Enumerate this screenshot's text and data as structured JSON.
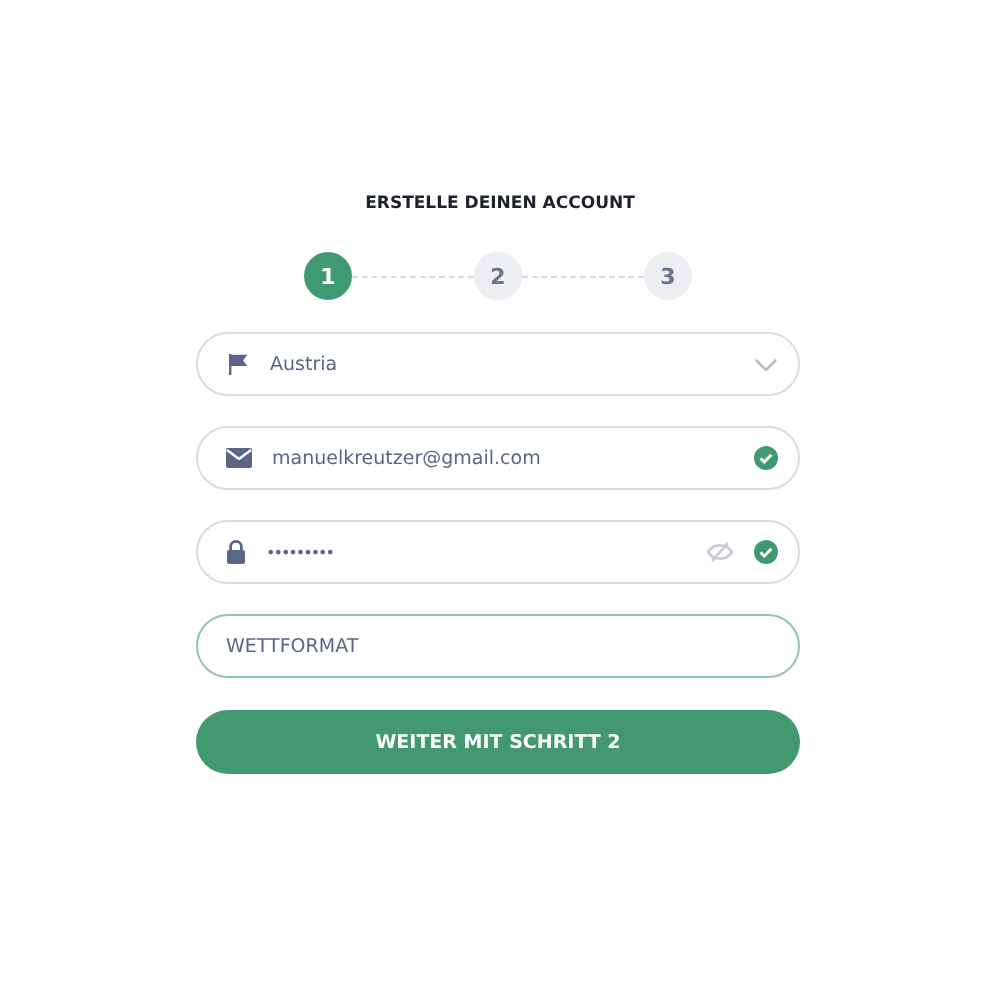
{
  "title": "ERSTELLE DEINEN ACCOUNT",
  "steps": [
    {
      "label": "1",
      "selected": true
    },
    {
      "label": "2",
      "selected": false
    },
    {
      "label": "3",
      "selected": false
    }
  ],
  "fields": [
    {
      "kind": "select",
      "value": "Austria",
      "valid": false,
      "focused": false
    },
    {
      "kind": "email",
      "value": "manuelkreutzer@gmail.com",
      "valid": true,
      "focused": false
    },
    {
      "kind": "password",
      "value": "•••••••••",
      "valid": true,
      "focused": false
    },
    {
      "kind": "text",
      "placeholder": "WETTFORMAT",
      "valid": false,
      "focused": true
    }
  ],
  "button": "WEITER MIT SCHRITT 2"
}
